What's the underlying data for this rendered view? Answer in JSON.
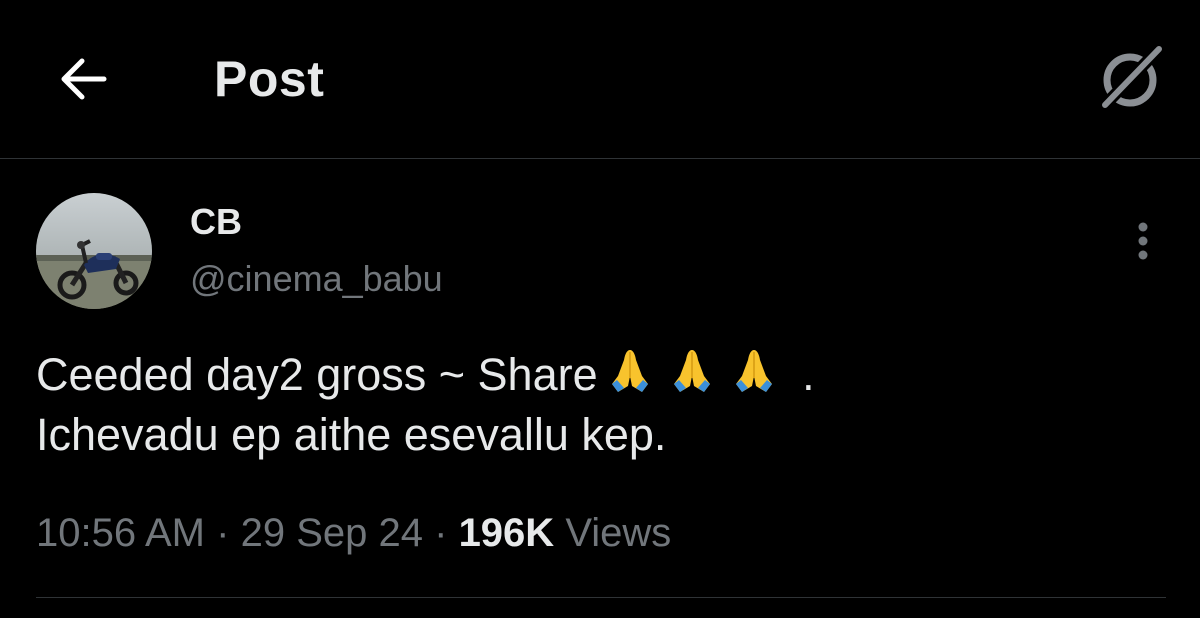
{
  "header": {
    "title": "Post",
    "back_icon": "arrow-left-icon",
    "right_icon": "grok-icon"
  },
  "post": {
    "author": {
      "display_name": "CB",
      "handle": "@cinema_babu",
      "avatar": "motorcycle-avatar"
    },
    "text_line1": "Ceeded day2 gross ~ Share",
    "emojis": [
      "folded-hands-emoji",
      "folded-hands-emoji",
      "folded-hands-emoji"
    ],
    "text_line1_suffix": ".",
    "text_line2": "Ichevadu ep aithe esevallu kep.",
    "time": "10:56 AM",
    "separator": "·",
    "date": "29 Sep 24",
    "views_count": "196K",
    "views_label": "Views"
  },
  "colors": {
    "background": "#000000",
    "primary_text": "#e7e9ea",
    "secondary_text": "#71767b",
    "divider": "#2f3336"
  }
}
